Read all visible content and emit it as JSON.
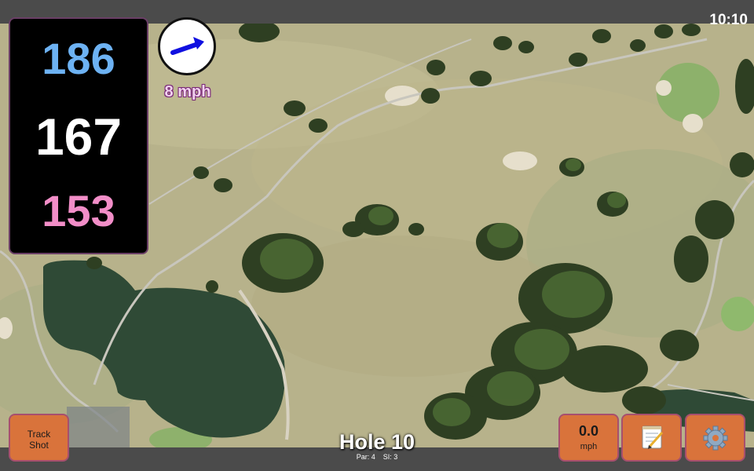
{
  "status": {
    "time": "10:10"
  },
  "distances": {
    "back": "186",
    "middle": "167",
    "front": "153"
  },
  "wind": {
    "speed_label": "8 mph",
    "arrow_color": "#1010e0"
  },
  "buttons": {
    "track_shot": "Track\nShot",
    "speed_value": "0.0",
    "speed_unit": "mph"
  },
  "hole": {
    "title": "Hole 10",
    "par": "Par: 4",
    "stroke_index": "SI: 3"
  },
  "icons": {
    "notes": "notepad-icon",
    "settings": "gear-icon"
  },
  "colors": {
    "button": "#d9733b",
    "back": "#6db2f3",
    "front": "#f28ec8",
    "wind_text": "#f2d2ef"
  }
}
